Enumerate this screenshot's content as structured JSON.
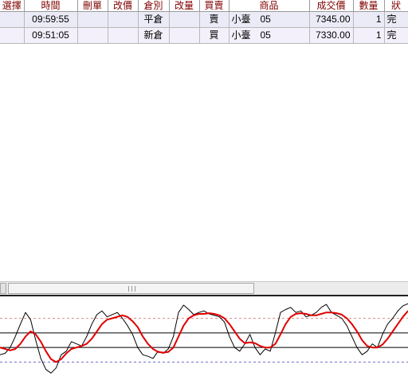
{
  "table": {
    "headers": [
      "選擇",
      "時間",
      "刪單",
      "改價",
      "倉別",
      "改量",
      "買賣",
      "商品",
      "成交價",
      "數量",
      "狀"
    ],
    "rows": [
      {
        "select": "",
        "time": "09:59:55",
        "delete": "",
        "modify": "",
        "position": "平倉",
        "qty_change": "",
        "side": "賣",
        "product": "小臺　05",
        "price": "7345.00",
        "qty": "1",
        "status": "完"
      },
      {
        "select": "",
        "time": "09:51:05",
        "delete": "",
        "modify": "",
        "position": "新倉",
        "qty_change": "",
        "side": "買",
        "product": "小臺　05",
        "price": "7330.00",
        "qty": "1",
        "status": "完"
      }
    ]
  },
  "scrollbar": {
    "grip_icon": "grip-lines-icon",
    "left_icon": "scroll-left-arrow-icon"
  },
  "indicator": {
    "colors": {
      "fast": "#000000",
      "slow": "#e00000",
      "upper_ref": "#e09090",
      "lower_ref": "#7070d0",
      "level": "#000000"
    },
    "ref_lines": {
      "upper": 80,
      "lower": 20
    },
    "level_lines": [
      60,
      40
    ],
    "range": [
      -10,
      110
    ],
    "fast_values": [
      30,
      32,
      40,
      55,
      72,
      88,
      78,
      50,
      25,
      10,
      5,
      12,
      30,
      35,
      48,
      45,
      42,
      55,
      72,
      85,
      90,
      82,
      85,
      88,
      80,
      70,
      58,
      40,
      30,
      28,
      25,
      35,
      32,
      38,
      55,
      88,
      98,
      92,
      85,
      88,
      90,
      86,
      84,
      82,
      75,
      55,
      40,
      35,
      45,
      58,
      40,
      30,
      38,
      35,
      60,
      88,
      92,
      95,
      88,
      90,
      82,
      84,
      88,
      95,
      99,
      88,
      84,
      80,
      70,
      55,
      40,
      30,
      35,
      45,
      40,
      58,
      72,
      80,
      90,
      97,
      100
    ],
    "slow_values": [
      40,
      38,
      36,
      38,
      45,
      55,
      62,
      58,
      48,
      35,
      24,
      20,
      24,
      32,
      38,
      40,
      42,
      45,
      52,
      62,
      72,
      78,
      80,
      82,
      84,
      82,
      76,
      68,
      55,
      45,
      38,
      34,
      33,
      34,
      40,
      55,
      70,
      80,
      84,
      86,
      86,
      87,
      86,
      84,
      80,
      72,
      62,
      52,
      46,
      47,
      46,
      42,
      40,
      40,
      45,
      58,
      72,
      82,
      86,
      87,
      86,
      84,
      84,
      86,
      88,
      88,
      87,
      85,
      80,
      72,
      62,
      50,
      42,
      40,
      40,
      44,
      52,
      62,
      72,
      82,
      90
    ]
  }
}
